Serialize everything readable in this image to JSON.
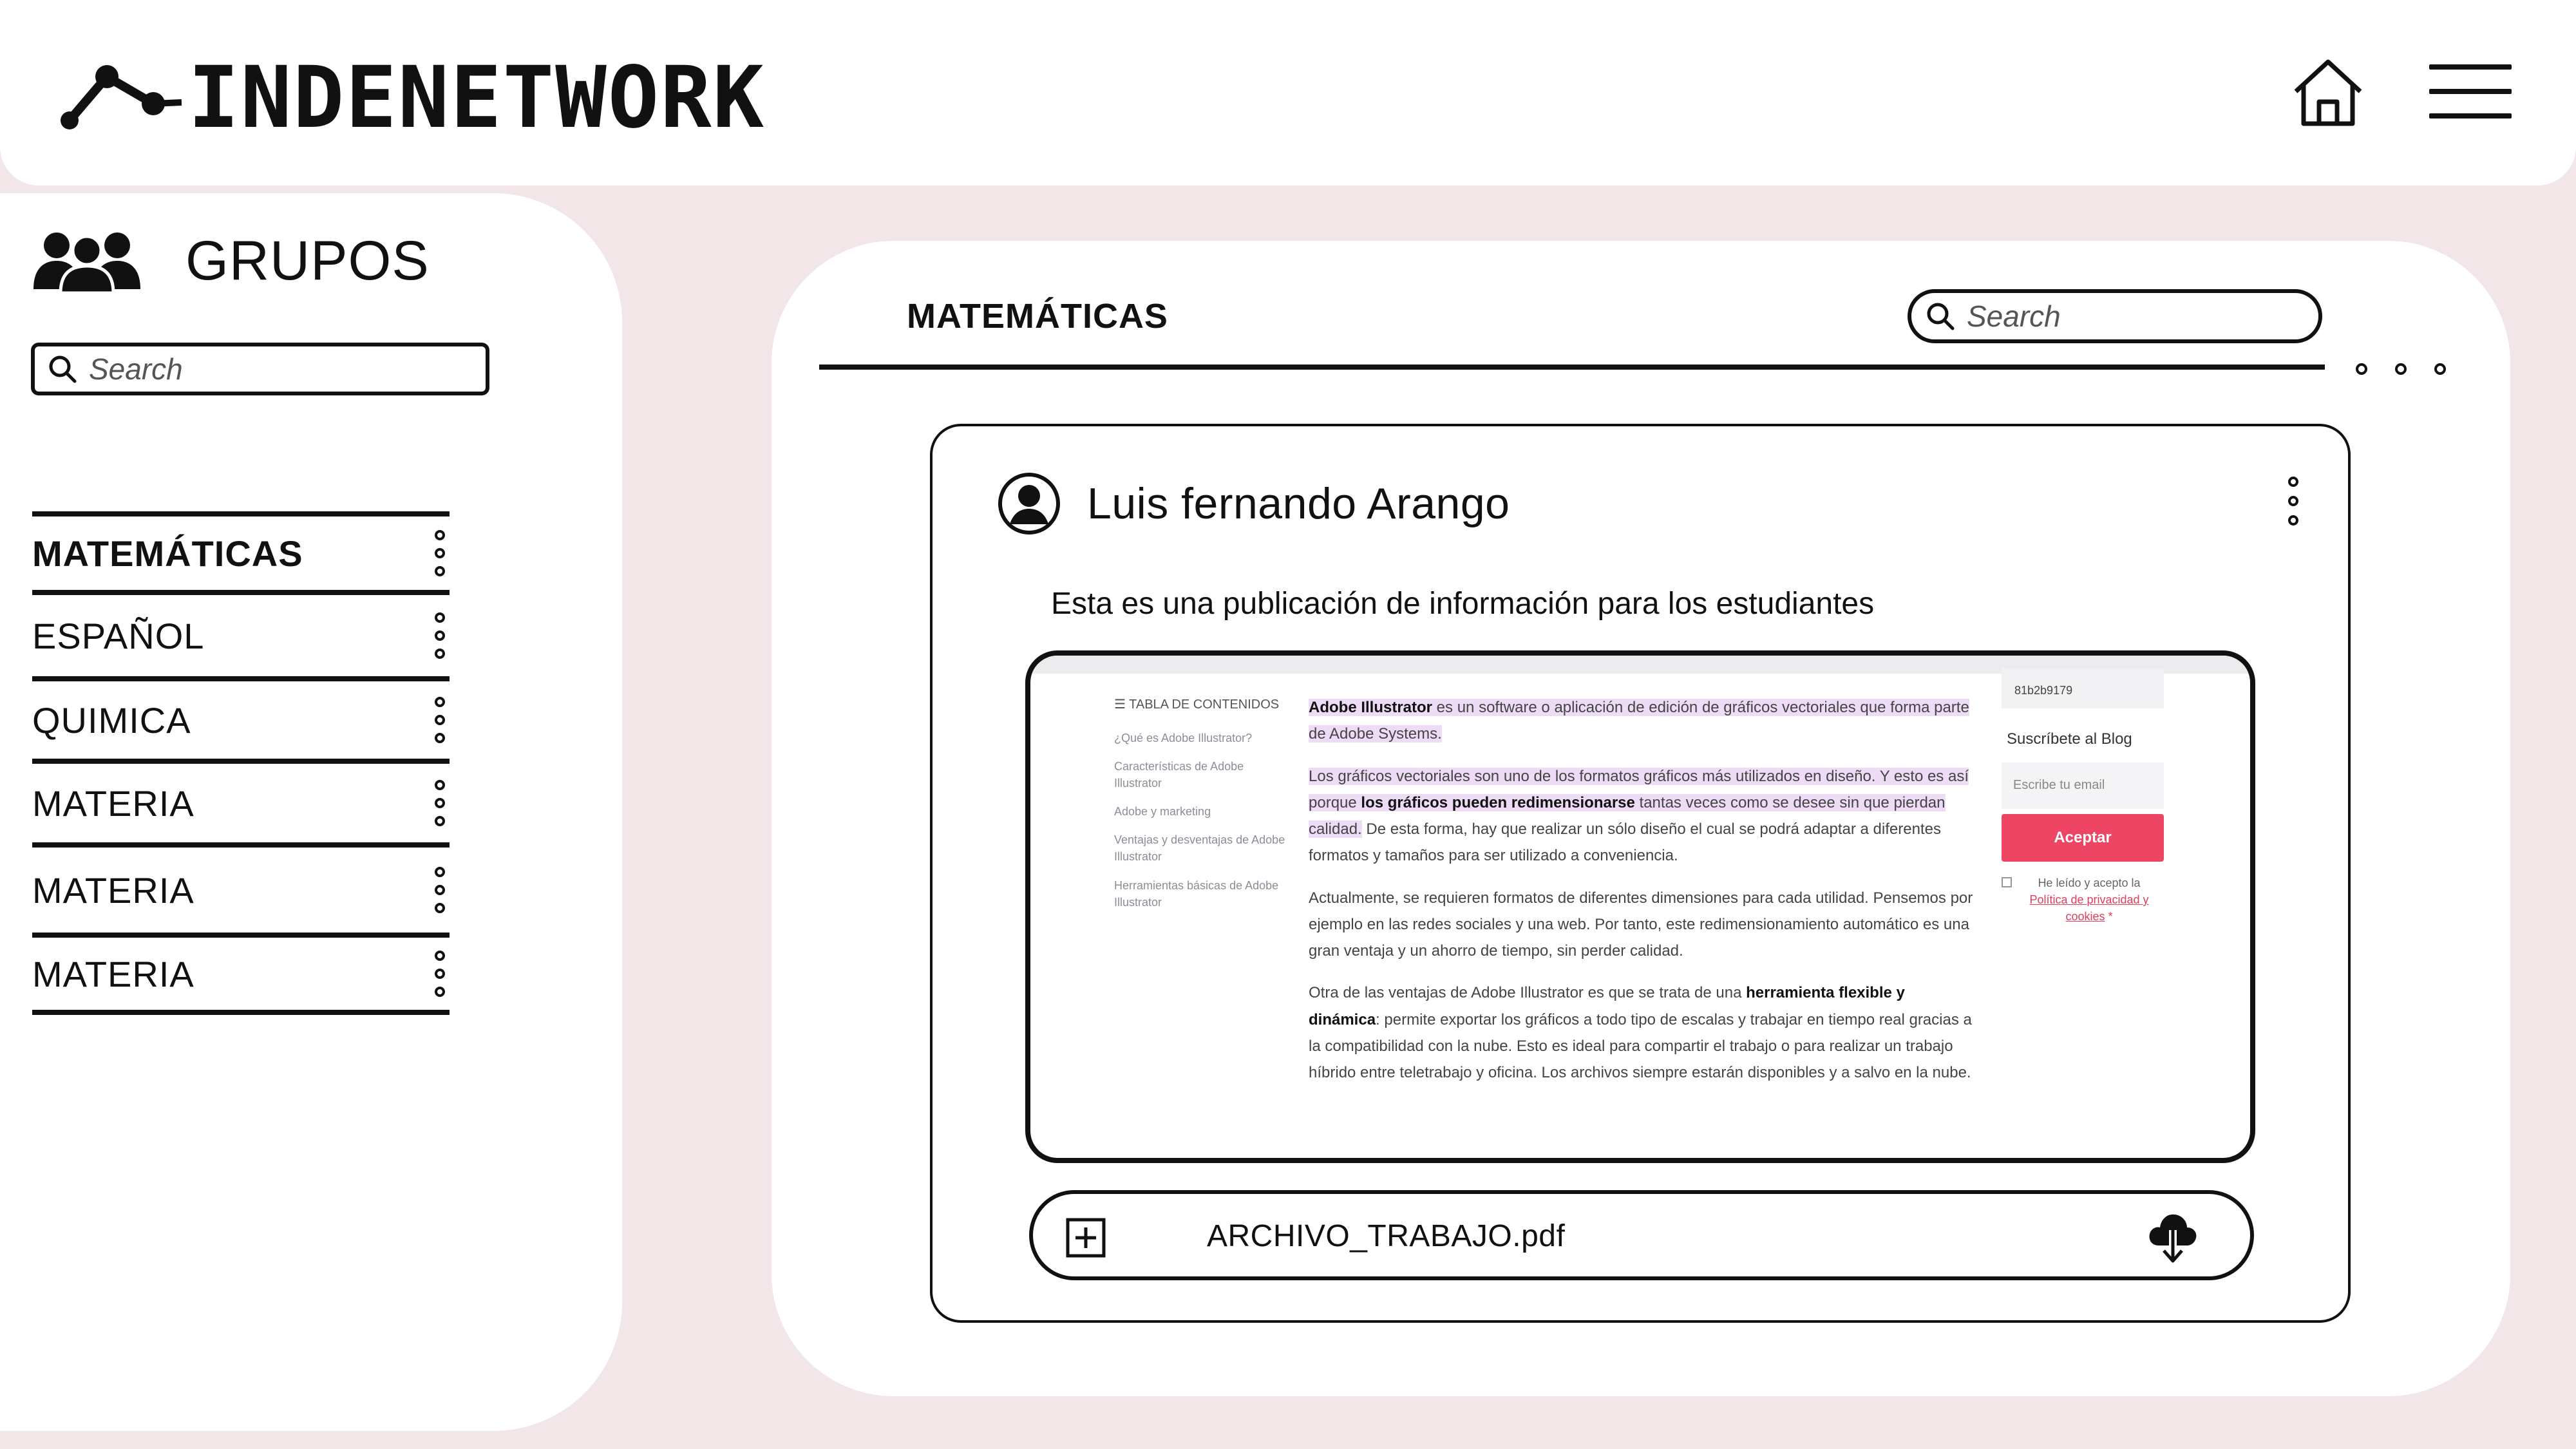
{
  "header": {
    "logo_text": "INDENETWORK",
    "home_icon": "home-icon",
    "menu_icon": "hamburger-menu-icon"
  },
  "sidebar": {
    "title": "GRUPOS",
    "title_icon": "users-group-icon",
    "search_placeholder": "Search",
    "groups": [
      {
        "label": "MATEMÁTICAS",
        "active": true
      },
      {
        "label": "ESPAÑOL",
        "active": false
      },
      {
        "label": "QUIMICA",
        "active": false
      },
      {
        "label": "MATERIA",
        "active": false
      },
      {
        "label": "MATERIA",
        "active": false
      },
      {
        "label": "MATERIA",
        "active": false
      }
    ]
  },
  "main": {
    "title": "MATEMÁTICAS",
    "search_placeholder": "Search",
    "post": {
      "author": "Luis fernando  Arango",
      "body": "Esta es una publicación de información para los estudiantes",
      "embedded": {
        "toc_title": "TABLA DE CONTENIDOS",
        "toc_items": [
          "¿Qué es Adobe Illustrator?",
          "Características de Adobe Illustrator",
          "Adobe y marketing",
          "Ventajas y desventajas de Adobe Illustrator",
          "Herramientas básicas de Adobe Illustrator"
        ],
        "p1_bold": "Adobe Illustrator",
        "p1_text": " es un software o aplicación de edición de gráficos vectoriales que forma parte de Adobe Systems.",
        "p2_a": "Los gráficos vectoriales son uno de los formatos gráficos más utilizados en diseño. Y esto es así porque ",
        "p2_bold": "los gráficos pueden redimensionarse",
        "p2_b": " tantas veces como se desee sin que pierdan calidad.",
        "p2_c": " De esta forma, hay que realizar un sólo diseño el cual se podrá adaptar a diferentes formatos y tamaños para ser utilizado a conveniencia.",
        "p3": "Actualmente, se requieren formatos de diferentes dimensiones para cada utilidad. Pensemos por ejemplo en las redes sociales y una web. Por tanto, este redimensionamiento automático es una gran ventaja y un ahorro de tiempo, sin perder calidad.",
        "p4_a": "Otra de las ventajas de Adobe Illustrator es que se trata de una ",
        "p4_bold": "herramienta flexible y dinámica",
        "p4_b": ": permite exportar los gráficos a todo tipo de escalas y trabajar en tiempo real gracias a la compatibilidad con la nube. Esto es ideal para compartir el trabajo o para realizar un trabajo híbrido entre teletrabajo y oficina. Los archivos siempre estarán disponibles y a salvo en la nube.",
        "code": "81b2b9179",
        "subscribe_title": "Suscríbete al Blog",
        "email_placeholder": "Escribe tu email",
        "accept_label": "Aceptar",
        "consent_text": "He leído y acepto la",
        "consent_link": "Política de privacidad y cookies",
        "consent_mark": " *",
        "accent_color": "#ef4565",
        "highlight_color": "#eedcf6"
      },
      "attachment": {
        "filename": "ARCHIVO_TRABAJO.pdf",
        "add_icon": "plus-square-icon",
        "download_icon": "cloud-download-icon"
      }
    }
  },
  "colors": {
    "background": "#f3e6e8",
    "panel": "#ffffff",
    "ink": "#111111"
  }
}
